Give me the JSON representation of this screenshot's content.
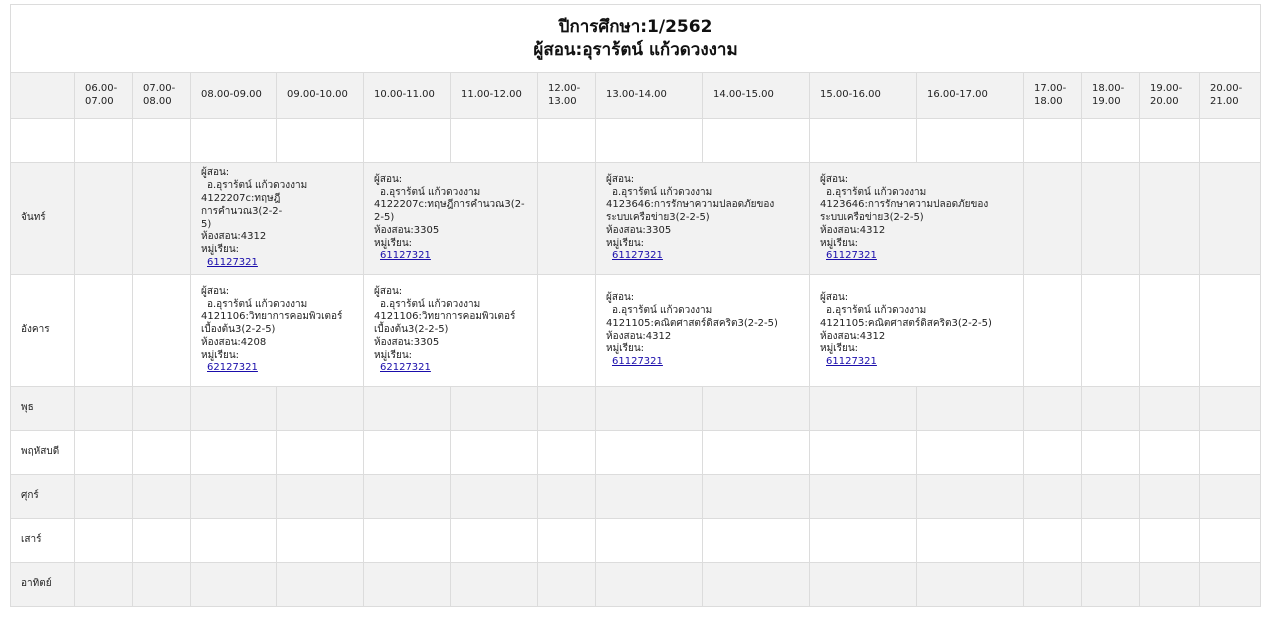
{
  "header": {
    "year_line": "ปีการศึกษา:1/2562",
    "teacher_line": "ผู้สอน:อุราร้ตน์ แก้วดวงงาม"
  },
  "time_slots": [
    "06.00-07.00",
    "07.00-08.00",
    "08.00-09.00",
    "09.00-10.00",
    "10.00-11.00",
    "11.00-12.00",
    "12.00-13.00",
    "13.00-14.00",
    "14.00-15.00",
    "15.00-16.00",
    "16.00-17.00",
    "17.00-18.00",
    "18.00-19.00",
    "19.00-20.00",
    "20.00-21.00"
  ],
  "days": {
    "mon": "จันทร์",
    "tue": "อังคาร",
    "wed": "พุธ",
    "thu": "พฤหัสบดี",
    "fri": "ศุกร์",
    "sat": "เสาร์",
    "sun": "อาทิตย์"
  },
  "classes": {
    "mon_0800": {
      "teacher_label": "ผู้สอน:",
      "teacher": "อ.อุราร้ตน์ แก้วดวงงาม",
      "course": "4122207c:ทฤษฎีการคำนวณ3(2-2-5)",
      "room": "ห้องสอน:4312",
      "group_label": "หมู่เรียน:",
      "group": "61127321"
    },
    "mon_1000": {
      "teacher_label": "ผู้สอน:",
      "teacher": "อ.อุราร้ตน์ แก้วดวงงาม",
      "course": "4122207c:ทฤษฎีการคำนวณ3(2-2-5)",
      "room": "ห้องสอน:3305",
      "group_label": "หมู่เรียน:",
      "group": "61127321"
    },
    "mon_1300": {
      "teacher_label": "ผู้สอน:",
      "teacher": "อ.อุราร้ตน์ แก้วดวงงาม",
      "course": "4123646:การรักษาความปลอดภัยของระบบเครือข่าย3(2-2-5)",
      "room": "ห้องสอน:3305",
      "group_label": "หมู่เรียน:",
      "group": "61127321"
    },
    "mon_1500": {
      "teacher_label": "ผู้สอน:",
      "teacher": "อ.อุราร้ตน์ แก้วดวงงาม",
      "course": "4123646:การรักษาความปลอดภัยของระบบเครือข่าย3(2-2-5)",
      "room": "ห้องสอน:4312",
      "group_label": "หมู่เรียน:",
      "group": "61127321"
    },
    "tue_0800": {
      "teacher_label": "ผู้สอน:",
      "teacher": "อ.อุราร้ตน์ แก้วดวงงาม",
      "course": "4121106:วิทยาการคอมพิวเตอร์เบื้องต้น3(2-2-5)",
      "room": "ห้องสอน:4208",
      "group_label": "หมู่เรียน:",
      "group": "62127321"
    },
    "tue_1000": {
      "teacher_label": "ผู้สอน:",
      "teacher": "อ.อุราร้ตน์ แก้วดวงงาม",
      "course": "4121106:วิทยาการคอมพิวเตอร์เบื้องต้น3(2-2-5)",
      "room": "ห้องสอน:3305",
      "group_label": "หมู่เรียน:",
      "group": "62127321"
    },
    "tue_1300": {
      "teacher_label": "ผู้สอน:",
      "teacher": "อ.อุราร้ตน์ แก้วดวงงาม",
      "course": "4121105:คณิตศาสตร์ดิสคริต3(2-2-5)",
      "room": "ห้องสอน:4312",
      "group_label": "หมู่เรียน:",
      "group": "61127321"
    },
    "tue_1500": {
      "teacher_label": "ผู้สอน:",
      "teacher": "อ.อุราร้ตน์ แก้วดวงงาม",
      "course": "4121105:คณิตศาสตร์ดิสคริต3(2-2-5)",
      "room": "ห้องสอน:4312",
      "group_label": "หมู่เรียน:",
      "group": "61127321"
    }
  }
}
